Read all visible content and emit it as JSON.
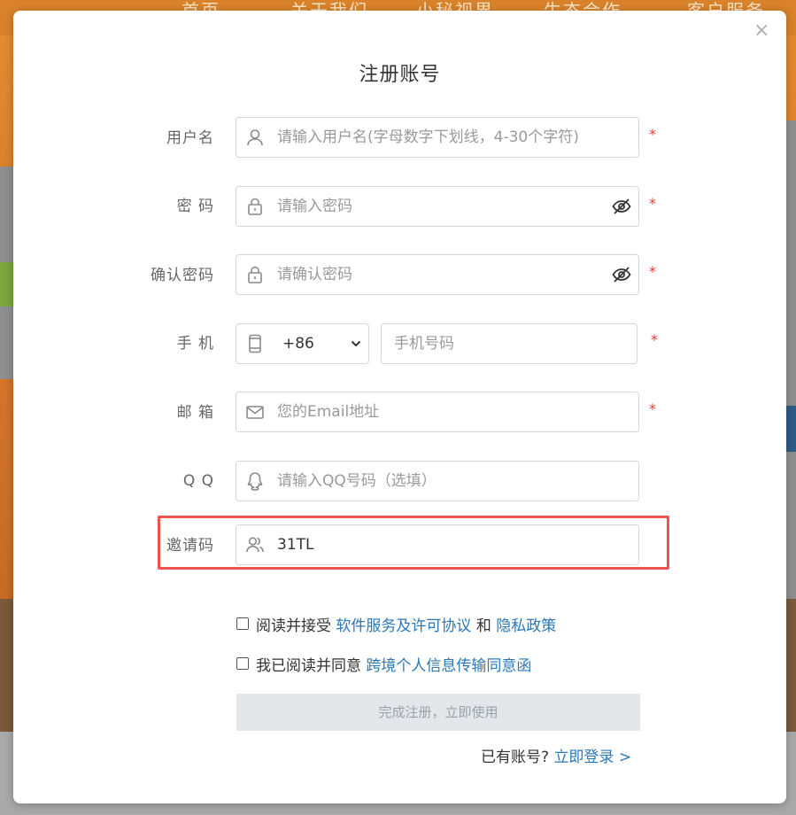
{
  "background": {
    "nav_items": [
      "首页",
      "关于我们",
      "小秘视界",
      "生态合作",
      "客户服务"
    ]
  },
  "modal": {
    "title": "注册账号",
    "close_symbol": "×",
    "fields": {
      "username": {
        "label": "用户名",
        "placeholder": "请输入用户名(字母数字下划线，4-30个字符)",
        "required": "*",
        "icon": "user-icon"
      },
      "password": {
        "label": "密 码",
        "placeholder": "请输入密码",
        "required": "*",
        "icon": "lock-icon"
      },
      "confirm_password": {
        "label": "确认密码",
        "placeholder": "请确认密码",
        "required": "*",
        "icon": "lock-icon"
      },
      "phone": {
        "label": "手 机",
        "country_code": "+86",
        "placeholder": "手机号码",
        "required": "*",
        "icon": "phone-icon"
      },
      "email": {
        "label": "邮 箱",
        "placeholder": "您的Email地址",
        "required": "*",
        "icon": "mail-icon"
      },
      "qq": {
        "label": "Q Q",
        "placeholder": "请输入QQ号码（选填）",
        "icon": "qq-icon"
      },
      "invite": {
        "label": "邀请码",
        "value": "31TL",
        "icon": "users-icon"
      }
    },
    "agreements": {
      "first": {
        "prefix": "阅读并接受",
        "link1": "软件服务及许可协议",
        "and": "和",
        "link2": "隐私政策"
      },
      "second": {
        "prefix": "我已阅读并同意",
        "link": "跨境个人信息传输同意函"
      }
    },
    "submit_label": "完成注册，立即使用",
    "login": {
      "prompt": "已有账号?",
      "link": "立即登录 >"
    }
  },
  "colors": {
    "required": "#e53935",
    "link": "#2a78b8",
    "highlight": "#ef5350"
  }
}
